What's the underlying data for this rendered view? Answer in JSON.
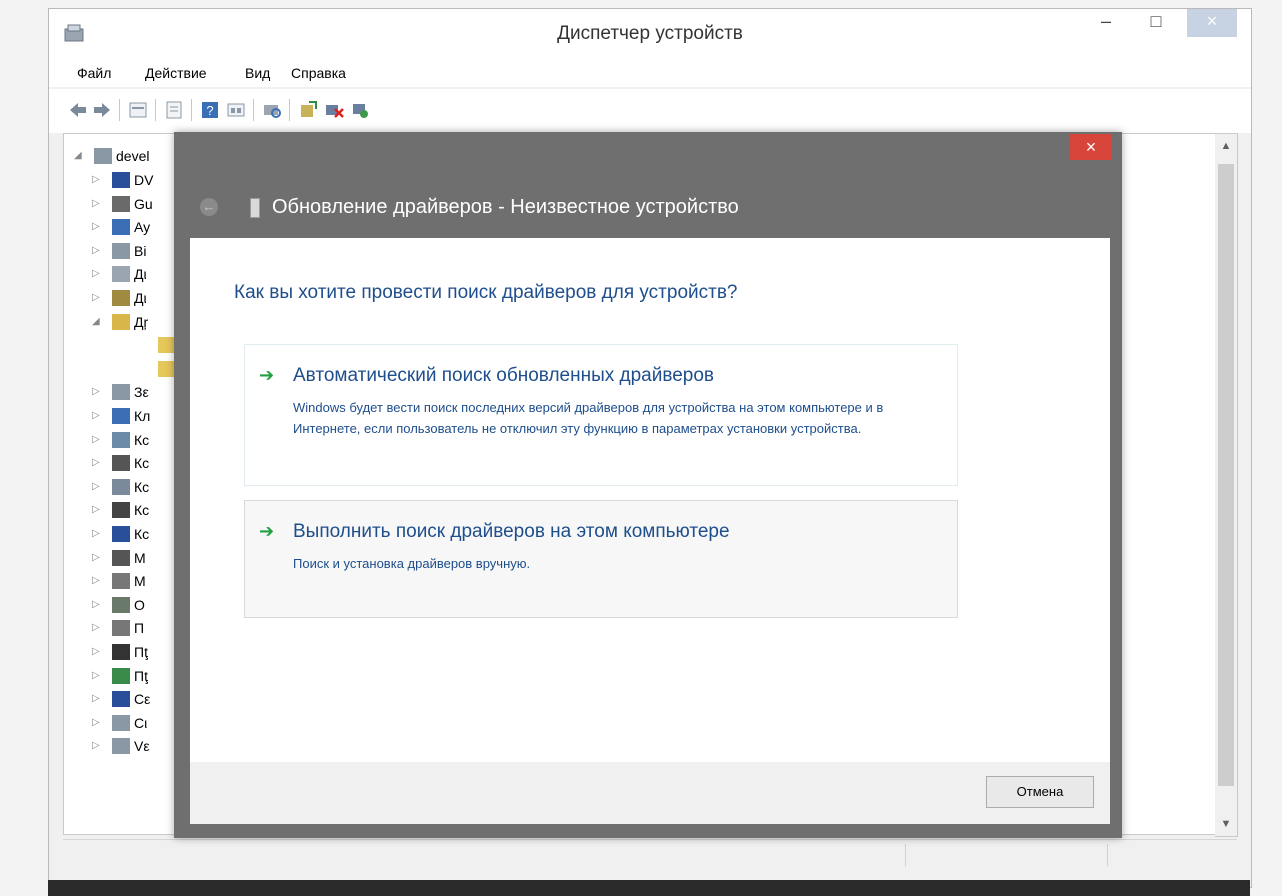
{
  "window": {
    "title": "Диспетчер устройств",
    "min_symbol": "–",
    "max_symbol": "□",
    "close_symbol": "×"
  },
  "menu": [
    "Файл",
    "Действие",
    "Вид",
    "Справка"
  ],
  "tree": {
    "root_label": "devel",
    "items": [
      "DV",
      "Gu",
      "Ay",
      "Bi",
      "Дι",
      "Дι",
      "Дŗ",
      "",
      "",
      "Зε",
      "Кл",
      "Кс",
      "Кс",
      "Кс",
      "Кс",
      "Кс",
      "M",
      "M",
      "O",
      "П",
      "Пţ",
      "Пţ",
      "Сε",
      "Сι",
      "Vε"
    ]
  },
  "dialog": {
    "close_symbol": "×",
    "back_symbol": "←",
    "title": "Обновление драйверов - Неизвестное устройство",
    "question": "Как вы хотите провести поиск драйверов для устройств?",
    "option_auto": {
      "title": "Автоматический поиск обновленных драйверов",
      "description": "Windows будет вести поиск последних версий драйверов для устройства на этом компьютере и в Интернете, если пользователь не отключил эту функцию в параметрах установки устройства."
    },
    "option_manual": {
      "title": "Выполнить поиск драйверов на этом компьютере",
      "description": "Поиск и установка драйверов вручную."
    },
    "cancel_label": "Отмена"
  },
  "colors": {
    "link_blue": "#1e4e8c",
    "arrow_green": "#20a040",
    "dialog_frame": "#6f6f6f",
    "close_red": "#d8453b"
  }
}
